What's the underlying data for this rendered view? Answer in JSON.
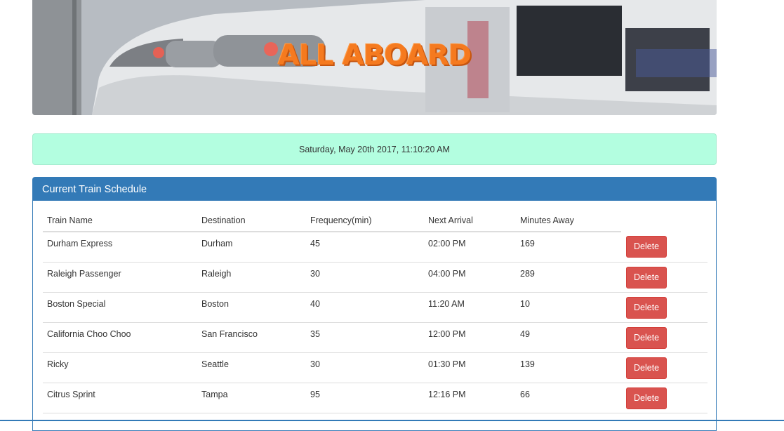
{
  "hero": {
    "title": "ALL ABOARD",
    "title_color": "#f57a1f"
  },
  "current_time": "Saturday, May 20th 2017, 11:10:20 AM",
  "panel": {
    "heading": "Current Train Schedule",
    "columns": [
      "Train Name",
      "Destination",
      "Frequency(min)",
      "Next Arrival",
      "Minutes Away"
    ],
    "delete_label": "Delete",
    "rows": [
      {
        "name": "Durham Express",
        "destination": "Durham",
        "frequency": "45",
        "next_arrival": "02:00 PM",
        "minutes_away": "169"
      },
      {
        "name": "Raleigh Passenger",
        "destination": "Raleigh",
        "frequency": "30",
        "next_arrival": "04:00 PM",
        "minutes_away": "289"
      },
      {
        "name": "Boston Special",
        "destination": "Boston",
        "frequency": "40",
        "next_arrival": "11:20 AM",
        "minutes_away": "10"
      },
      {
        "name": "California Choo Choo",
        "destination": "San Francisco",
        "frequency": "35",
        "next_arrival": "12:00 PM",
        "minutes_away": "49"
      },
      {
        "name": "Ricky",
        "destination": "Seattle",
        "frequency": "30",
        "next_arrival": "01:30 PM",
        "minutes_away": "139"
      },
      {
        "name": "Citrus Sprint",
        "destination": "Tampa",
        "frequency": "95",
        "next_arrival": "12:16 PM",
        "minutes_away": "66"
      }
    ]
  },
  "colors": {
    "primary": "#337ab7",
    "success_bg": "#b3fee0",
    "danger": "#d9534f"
  }
}
